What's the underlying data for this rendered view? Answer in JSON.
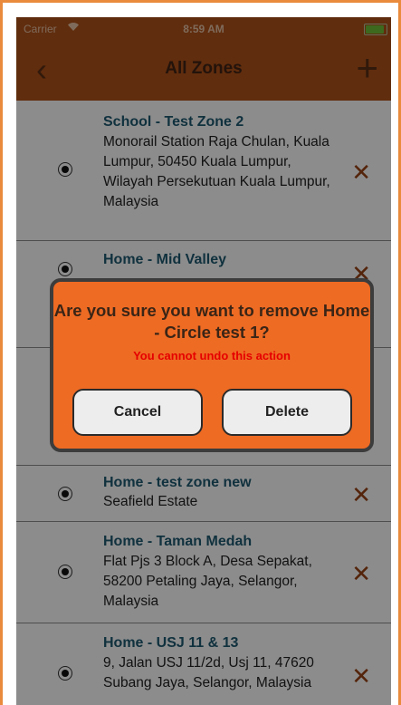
{
  "status_bar": {
    "carrier": "Carrier",
    "wifi_icon": "wifi-icon",
    "time": "8:59 AM",
    "battery_icon": "battery-icon"
  },
  "nav": {
    "title": "All Zones",
    "back_glyph": "‹",
    "add_glyph": "+"
  },
  "zones": [
    {
      "title": "School - Test Zone 2",
      "address": "Monorail Station Raja Chulan, Kuala Lumpur, 50450 Kuala Lumpur, Wilayah Persekutuan Kuala Lumpur, Malaysia"
    },
    {
      "title": "Home - Mid Valley",
      "address": ""
    },
    {
      "title": "Home - test zone new",
      "address": "Seafield Estate"
    },
    {
      "title": "Home - Taman Medah",
      "address": "Flat Pjs 3 Block A, Desa Sepakat, 58200 Petaling Jaya, Selangor, Malaysia"
    },
    {
      "title": "Home - USJ 11 & 13",
      "address": "9, Jalan USJ 11/2d, Usj 11, 47620 Subang Jaya, Selangor, Malaysia"
    }
  ],
  "delete_glyph": "✕",
  "dialog": {
    "title": "Are you sure you want to remove Home - Circle test 1?",
    "warning": "You cannot undo this action",
    "cancel_label": "Cancel",
    "delete_label": "Delete"
  },
  "colors": {
    "nav_background": "#b0521a",
    "dialog_background": "#ee6b24",
    "warning_text": "#e60000",
    "zone_title": "#1e5a72"
  }
}
